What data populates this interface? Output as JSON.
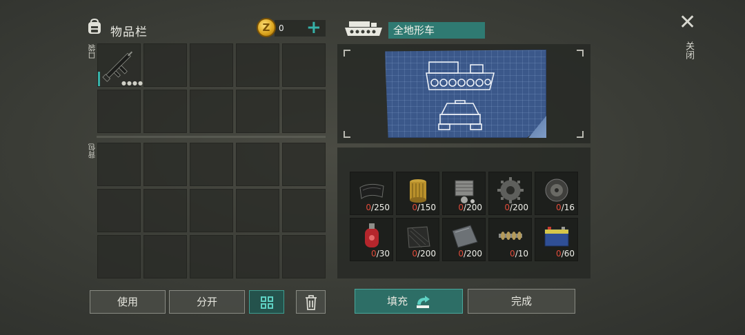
{
  "inventory": {
    "title": "物品栏",
    "pocket_label": "口袋",
    "backpack_label": "背包",
    "coins": "0",
    "add_symbol": "+",
    "coin_symbol": "Z",
    "first_slot_item": "assault-rifle-icon"
  },
  "vehicle": {
    "name": "全地形车",
    "icon": "tracked-vehicle-icon",
    "blueprint": "vehicle-blueprint-icon"
  },
  "close": {
    "symbol": "✕",
    "label": "关闭"
  },
  "materials": [
    {
      "name": "rubber-sheet-icon",
      "have": "0",
      "need": "/250"
    },
    {
      "name": "oil-filter-icon",
      "have": "0",
      "need": "/150"
    },
    {
      "name": "engine-cylinder-icon",
      "have": "0",
      "need": "/200"
    },
    {
      "name": "gear-icon",
      "have": "0",
      "need": "/200"
    },
    {
      "name": "wheel-disc-icon",
      "have": "0",
      "need": "/16"
    },
    {
      "name": "gas-cylinder-icon",
      "have": "0",
      "need": "/30"
    },
    {
      "name": "carbon-fiber-icon",
      "have": "0",
      "need": "/200"
    },
    {
      "name": "metal-plate-icon",
      "have": "0",
      "need": "/200"
    },
    {
      "name": "camshaft-icon",
      "have": "0",
      "need": "/10"
    },
    {
      "name": "battery-icon",
      "have": "0",
      "need": "/60"
    }
  ],
  "buttons": {
    "use": "使用",
    "split": "分开",
    "fill": "填充",
    "complete": "完成"
  },
  "colors": {
    "accent": "#2f7a72",
    "count_zero": "#e14b3a",
    "coin": "#d9a21c"
  }
}
